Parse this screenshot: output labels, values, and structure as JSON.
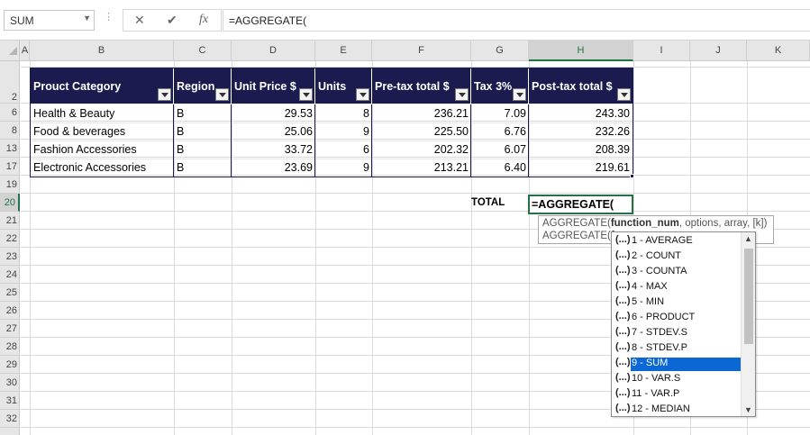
{
  "formula_bar": {
    "name_box": "SUM",
    "cancel_icon": "✕",
    "enter_icon": "✔",
    "fx_icon": "fx",
    "formula": "=AGGREGATE("
  },
  "columns": [
    "A",
    "B",
    "C",
    "D",
    "E",
    "F",
    "G",
    "H",
    "I",
    "J",
    "K"
  ],
  "rows": [
    "2",
    "6",
    "8",
    "13",
    "17",
    "19",
    "20",
    "21",
    "22",
    "23",
    "24",
    "25",
    "26",
    "27",
    "28",
    "29",
    "30",
    "31",
    "32"
  ],
  "table": {
    "headers": [
      "Prouct Category",
      "Region",
      "Unit Price $",
      "Units",
      "Pre-tax total $",
      "Tax 3%",
      "Post-tax total $"
    ],
    "rows": [
      [
        "Health & Beauty",
        "B",
        "29.53",
        "8",
        "236.21",
        "7.09",
        "243.30"
      ],
      [
        "Food & beverages",
        "B",
        "25.06",
        "9",
        "225.50",
        "6.76",
        "232.26"
      ],
      [
        "Fashion Accessories",
        "B",
        "33.72",
        "6",
        "202.32",
        "6.07",
        "208.39"
      ],
      [
        "Electronic Accessories",
        "B",
        "23.69",
        "9",
        "213.21",
        "6.40",
        "219.61"
      ]
    ]
  },
  "total": {
    "label": "TOTAL",
    "edit_text": "=AGGREGATE("
  },
  "tooltip": {
    "line1_prefix": "AGGREGATE(",
    "line1_bold": "function_num",
    "line1_suffix": ", options, array, [k])",
    "line2_prefix": "AGGREGATE(",
    "line2_bold": "fu"
  },
  "autocomplete": {
    "icon_text": "(...)",
    "items": [
      "1 - AVERAGE",
      "2 - COUNT",
      "3 - COUNTA",
      "4 - MAX",
      "5 - MIN",
      "6 - PRODUCT",
      "7 - STDEV.S",
      "8 - STDEV.P",
      "9 - SUM",
      "10 - VAR.S",
      "11 - VAR.P",
      "12 - MEDIAN"
    ],
    "selected": "9 - SUM",
    "scroll_up": "▲",
    "scroll_down": "▼"
  },
  "colors": {
    "header_bg": "#1b1b4f",
    "active_border": "#217346",
    "selection_blue": "#0b67d4"
  }
}
